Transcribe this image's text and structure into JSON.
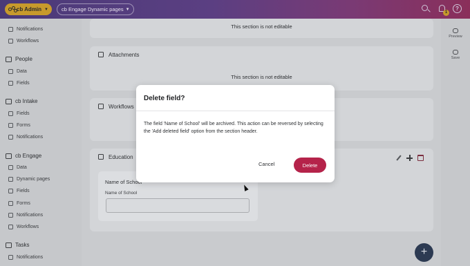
{
  "topbar": {
    "brand_label": "cb Admin",
    "app_selector": "cb Engage Dynamic pages",
    "notification_count": "1",
    "help_glyph": "?"
  },
  "sidebar": {
    "top_items": [
      {
        "label": "Notifications",
        "icon": "bell-icon"
      },
      {
        "label": "Workflows",
        "icon": "workflow-icon"
      }
    ],
    "groups": [
      {
        "label": "People",
        "icon": "people-icon",
        "items": [
          "Data",
          "Fields"
        ]
      },
      {
        "label": "cb Intake",
        "icon": "intake-icon",
        "items": [
          "Fields",
          "Forms",
          "Notifications"
        ]
      },
      {
        "label": "cb Engage",
        "icon": "engage-icon",
        "items": [
          "Data",
          "Dynamic pages",
          "Fields",
          "Forms",
          "Notifications",
          "Workflows"
        ]
      },
      {
        "label": "Tasks",
        "icon": "tasks-icon",
        "items": [
          "Notifications"
        ]
      }
    ]
  },
  "main": {
    "not_editable_text": "This section is not editable",
    "attachments_title": "Attachments",
    "workflows_title": "Workflows",
    "education": {
      "title": "Education",
      "field_name": "Name of School",
      "field_label": "Name of School"
    }
  },
  "rail": {
    "preview_label": "Preview",
    "save_label": "Save"
  },
  "fab_label": "+",
  "modal": {
    "title": "Delete field?",
    "body": "The field 'Name of School' will be archived. This action can be reversed by selecting the 'Add deleted field' option from the section header.",
    "cancel_label": "Cancel",
    "delete_label": "Delete"
  },
  "colors": {
    "delete_button": "#b5234a",
    "brand_pill": "#c79a2c",
    "fab": "#2c3a52"
  }
}
